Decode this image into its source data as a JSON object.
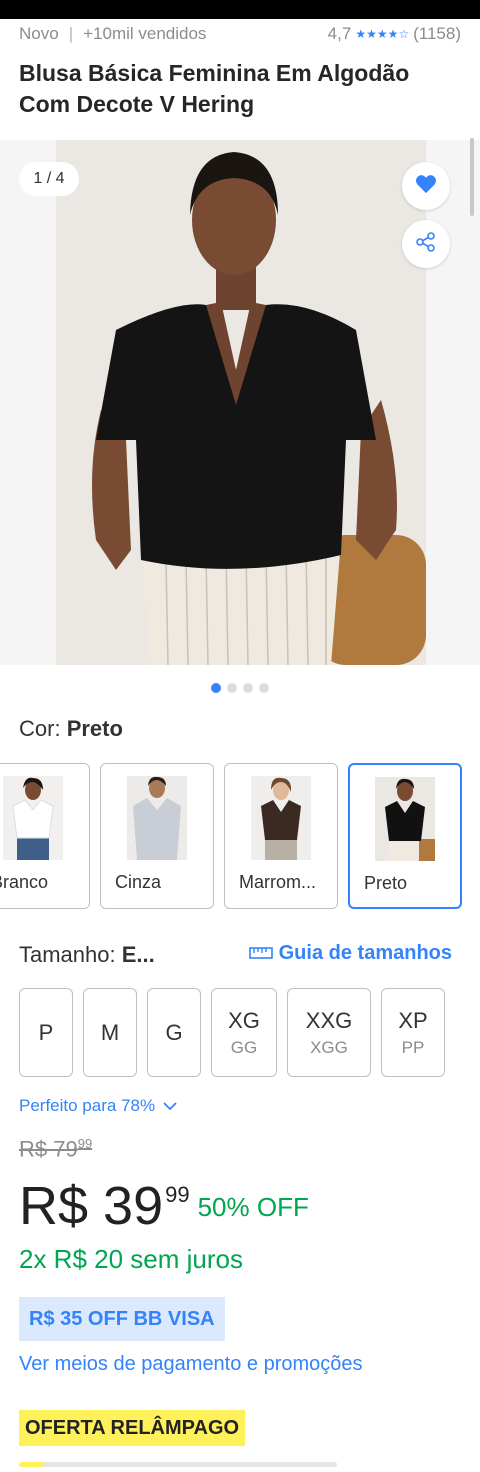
{
  "header": {
    "condition": "Novo",
    "sold": "+10mil vendidos",
    "rating": "4,7",
    "reviews_count": "(1158)"
  },
  "product": {
    "title": "Blusa Básica Feminina Em Algodão Com Decote V Hering"
  },
  "gallery": {
    "counter": "1 / 4",
    "total": 4,
    "active_index": 0
  },
  "color": {
    "label": "Cor:",
    "selected": "Preto",
    "options": [
      {
        "label": "Branco",
        "shirt_color": "#ffffff"
      },
      {
        "label": "Cinza",
        "shirt_color": "#c9ced6"
      },
      {
        "label": "Marrom...",
        "shirt_color": "#3a2a22"
      },
      {
        "label": "Preto",
        "shirt_color": "#111111"
      }
    ]
  },
  "size": {
    "label": "Tamanho:",
    "selected": "E...",
    "guide_link": "Guia de tamanhos",
    "options": [
      {
        "main": "P",
        "sub": ""
      },
      {
        "main": "M",
        "sub": ""
      },
      {
        "main": "G",
        "sub": ""
      },
      {
        "main": "XG",
        "sub": "GG"
      },
      {
        "main": "XXG",
        "sub": "XGG"
      },
      {
        "main": "XP",
        "sub": "PP"
      }
    ],
    "fit": "Perfeito para 78%"
  },
  "price": {
    "old_int": "R$ 79",
    "old_cents": "99",
    "current_int": "R$ 39",
    "current_cents": "99",
    "discount": "50% OFF",
    "installments": "2x R$ 20 sem juros",
    "coupon": "R$ 35 OFF BB VISA",
    "payment_link": "Ver meios de pagamento e promoções"
  },
  "promo": {
    "flash_label": "OFERTA RELÂMPAGO"
  },
  "colors": {
    "accent": "#3483fa",
    "green": "#00a650",
    "yellow": "#fff159"
  }
}
